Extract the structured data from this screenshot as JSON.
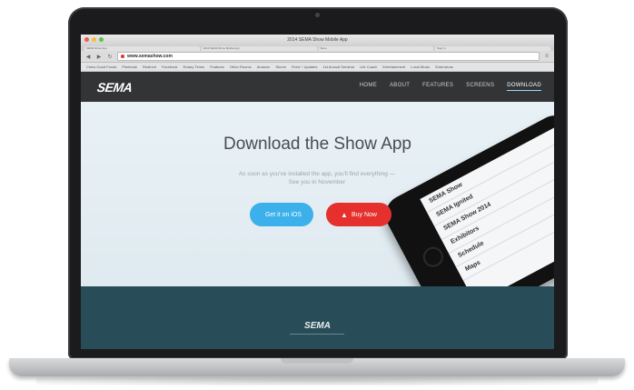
{
  "browser": {
    "window_title": "2014 SEMA Show Mobile App",
    "url": "www.semashow.com",
    "bookmarks": [
      "Chew Good Foods",
      "Pinebook",
      "Redirect",
      "Facebook",
      "Rotary Times",
      "Features",
      "Other Rooms",
      "Amazon",
      "Stores",
      "Feed + Updates",
      "1st Annual Seminar",
      "Life Coach",
      "Entertainment",
      "Local Music",
      "Extensions"
    ],
    "tabs": [
      "SEMA Show App",
      "2014 SEMA Show Mobile App",
      "Store",
      "Sign In"
    ]
  },
  "site": {
    "brand": "SEMA",
    "nav": [
      {
        "label": "HOME"
      },
      {
        "label": "ABOUT"
      },
      {
        "label": "FEATURES"
      },
      {
        "label": "SCREENS"
      },
      {
        "label": "DOWNLOAD"
      }
    ],
    "active_nav": "DOWNLOAD"
  },
  "hero": {
    "title": "Download the Show App",
    "subtitle": "As soon as you've installed the app, you'll find everything — See you in November",
    "apple_button": "Get it on iOS",
    "play_button": "Buy Now",
    "phone_rows": [
      "SEMA Show",
      "SEMA Ignited",
      "SEMA Show 2014",
      "Exhibitors",
      "Schedule",
      "Maps"
    ]
  },
  "footer": {
    "brand": "SEMA"
  },
  "colors": {
    "nav_bg": "#323436",
    "hero_bg": "#e8f1f6",
    "apple_button": "#3bb0ea",
    "play_button": "#e5302e",
    "footer_bg": "#294d58"
  }
}
